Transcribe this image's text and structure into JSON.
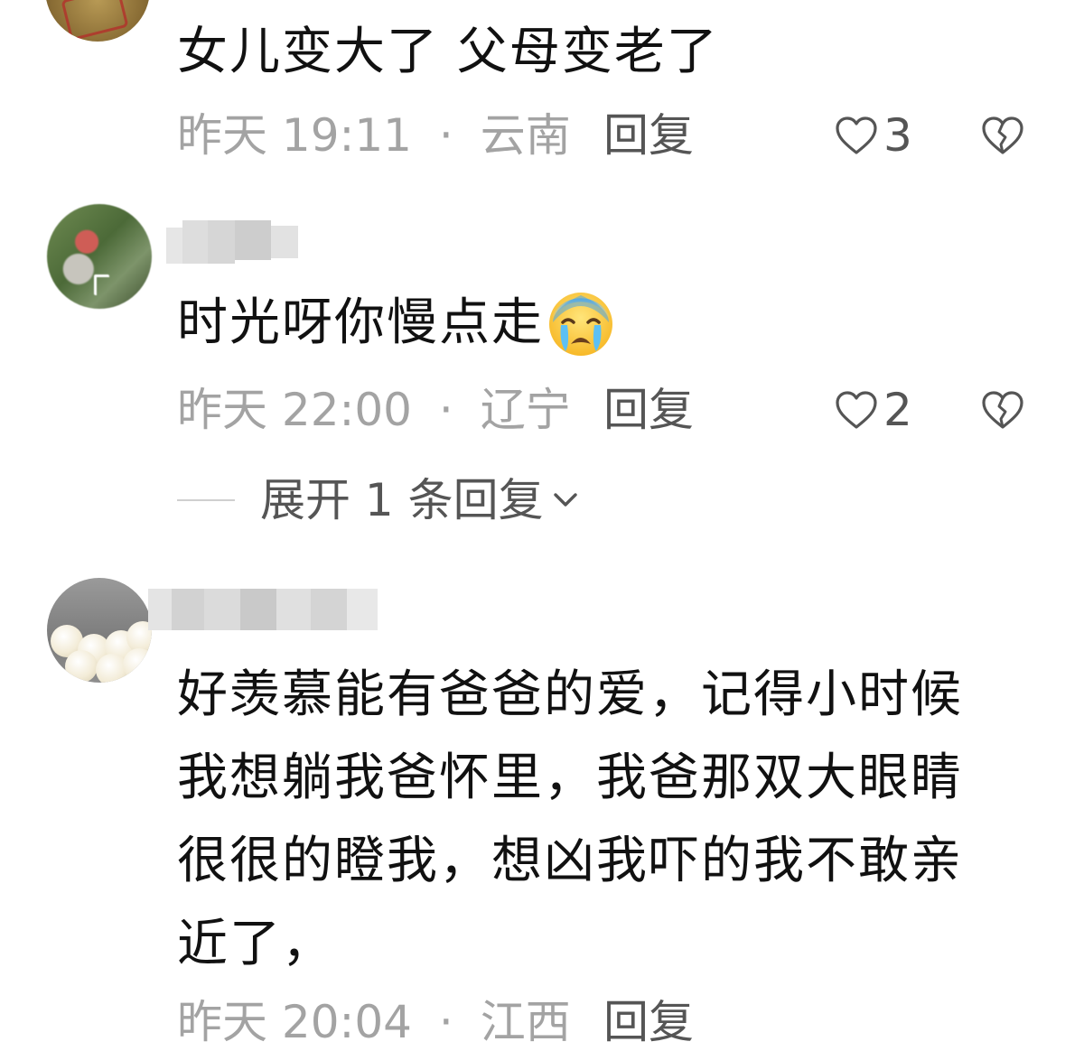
{
  "comments": [
    {
      "text_lines": [
        "女儿变大了  父母变老了"
      ],
      "time": "昨天 19:11",
      "separator": "·",
      "location": "云南",
      "reply_label": "回复",
      "like_count": "3"
    },
    {
      "text_lines": [
        "时光呀你慢点走"
      ],
      "emoji": "crying-face",
      "time": "昨天 22:00",
      "separator": "·",
      "location": "辽宁",
      "reply_label": "回复",
      "like_count": "2",
      "expand_label": "展开 1 条回复"
    },
    {
      "text_lines": [
        "好羡慕能有爸爸的爱，记得小时候",
        "我想躺我爸怀里，我爸那双大眼睛",
        "很很的瞪我，想凶我吓的我不敢亲",
        "近了，"
      ],
      "time": "昨天 20:04",
      "separator": "·",
      "location": "江西",
      "reply_label": "回复"
    }
  ],
  "icons": {
    "like": "heart-outline-icon",
    "dislike": "broken-heart-icon",
    "expand": "chevron-down-icon"
  },
  "colors": {
    "text": "#111111",
    "meta": "#a3a3a3",
    "action": "#555555"
  }
}
